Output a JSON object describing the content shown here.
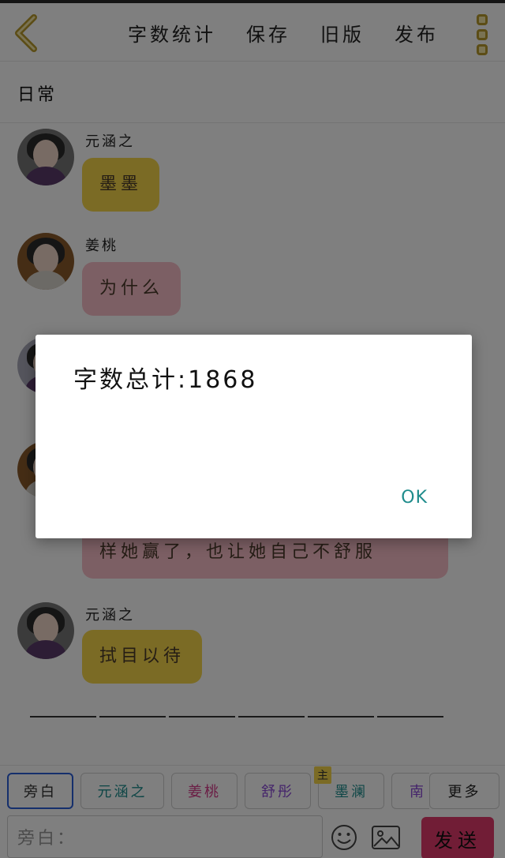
{
  "header": {
    "actions": [
      "字数统计",
      "保存",
      "旧版",
      "发布"
    ]
  },
  "chat": {
    "title": "日常",
    "messages": [
      {
        "sender": "元涵之",
        "text": "墨墨",
        "color": "#f6d64a"
      },
      {
        "sender": "姜桃",
        "text": "为什么",
        "color": "#f8bfc8"
      },
      {
        "sender": "",
        "text": "样她赢了，也让她自己不舒服",
        "color": "#f8bfc8"
      },
      {
        "sender": "元涵之",
        "text": "拭目以待",
        "color": "#f6d64a"
      }
    ]
  },
  "dialog": {
    "message": "字数总计:1868",
    "ok_label": "OK"
  },
  "roles": {
    "owner_badge": "主",
    "items": [
      {
        "label": "旁白",
        "color": "#333333"
      },
      {
        "label": "元涵之",
        "color": "#1a8c8c"
      },
      {
        "label": "姜桃",
        "color": "#d63a8a"
      },
      {
        "label": "舒彤",
        "color": "#8a4ad6"
      },
      {
        "label": "墨澜",
        "color": "#1a8c8c"
      },
      {
        "label": "南",
        "color": "#8a4ad6"
      },
      {
        "label": "更多",
        "color": "#222222"
      }
    ]
  },
  "composer": {
    "placeholder": "旁白：",
    "send_label": "发送"
  },
  "colors": {
    "accent_yellow": "#f6d64a",
    "accent_pink": "#f8bfc8",
    "send_button": "#e23a6d",
    "ok_text": "#1f8c8c",
    "active_chip_border": "#2b5fd9"
  }
}
